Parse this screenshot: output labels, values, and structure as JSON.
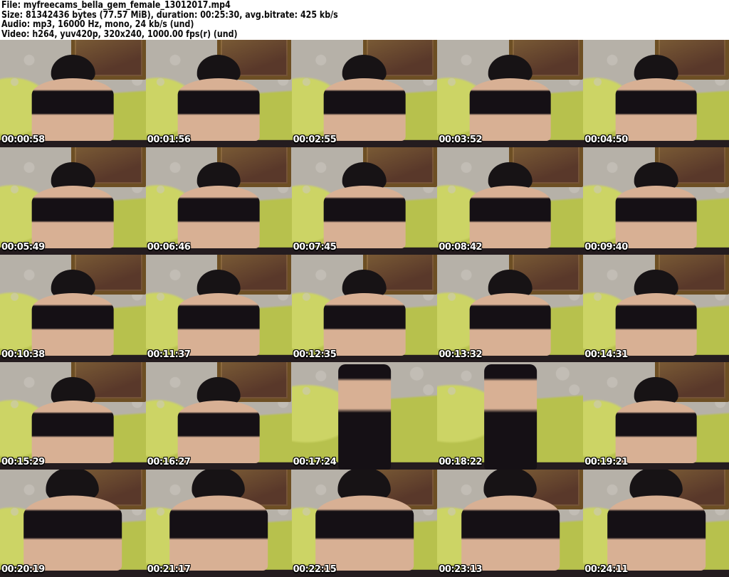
{
  "header": {
    "lines": [
      "File: myfreecams_bella_gem_female_13012017.mp4",
      "Size: 81342436 bytes (77.57 MiB), duration: 00:25:30, avg.bitrate: 425 kb/s",
      "Audio: mp3, 16000 Hz, mono, 24 kb/s (und)",
      "Video: h264, yuv420p, 320x240, 1000.00 fps(r) (und)"
    ]
  },
  "media": {
    "file": "myfreecams_bella_gem_female_13012017.mp4",
    "size_bytes": "81342436",
    "size_human": "77.57 MiB",
    "duration": "00:25:30",
    "avg_bitrate": "425 kb/s",
    "audio": "mp3, 16000 Hz, mono, 24 kb/s (und)",
    "video": "h264, yuv420p, 320x240, 1000.00 fps(r) (und)"
  },
  "grid": {
    "columns": 5,
    "rows": 5,
    "thumbnails": [
      {
        "timestamp": "00:00:58",
        "variant": "seated"
      },
      {
        "timestamp": "00:01:56",
        "variant": "seated"
      },
      {
        "timestamp": "00:02:55",
        "variant": "seated"
      },
      {
        "timestamp": "00:03:52",
        "variant": "seated"
      },
      {
        "timestamp": "00:04:50",
        "variant": "seated"
      },
      {
        "timestamp": "00:05:49",
        "variant": "seated"
      },
      {
        "timestamp": "00:06:46",
        "variant": "seated"
      },
      {
        "timestamp": "00:07:45",
        "variant": "seated"
      },
      {
        "timestamp": "00:08:42",
        "variant": "seated"
      },
      {
        "timestamp": "00:09:40",
        "variant": "seated"
      },
      {
        "timestamp": "00:10:38",
        "variant": "seated"
      },
      {
        "timestamp": "00:11:37",
        "variant": "seated"
      },
      {
        "timestamp": "00:12:35",
        "variant": "seated"
      },
      {
        "timestamp": "00:13:32",
        "variant": "seated"
      },
      {
        "timestamp": "00:14:31",
        "variant": "seated"
      },
      {
        "timestamp": "00:15:29",
        "variant": "seated"
      },
      {
        "timestamp": "00:16:27",
        "variant": "seated"
      },
      {
        "timestamp": "00:17:24",
        "variant": "standing"
      },
      {
        "timestamp": "00:18:22",
        "variant": "standing"
      },
      {
        "timestamp": "00:19:21",
        "variant": "seated"
      },
      {
        "timestamp": "00:20:19",
        "variant": "closeup"
      },
      {
        "timestamp": "00:21:17",
        "variant": "closeup"
      },
      {
        "timestamp": "00:22:15",
        "variant": "closeup"
      },
      {
        "timestamp": "00:23:13",
        "variant": "closeup"
      },
      {
        "timestamp": "00:24:11",
        "variant": "closeup"
      }
    ]
  },
  "palette": {
    "header_bg": "#ffffff",
    "header_text": "#0a0a0a",
    "couch": "#b7c14d",
    "couch_light": "#ccd465",
    "wall": "#b6b1a8",
    "wall_light": "#cdc8c0",
    "frame_border": "#6d4f24",
    "frame_fill": "#59382a",
    "hair": "#171315",
    "skin": "#d8b094",
    "garment": "#151015",
    "desk": "#241c1f",
    "timestamp_fill": "#ffffff",
    "timestamp_outline": "#000000"
  }
}
